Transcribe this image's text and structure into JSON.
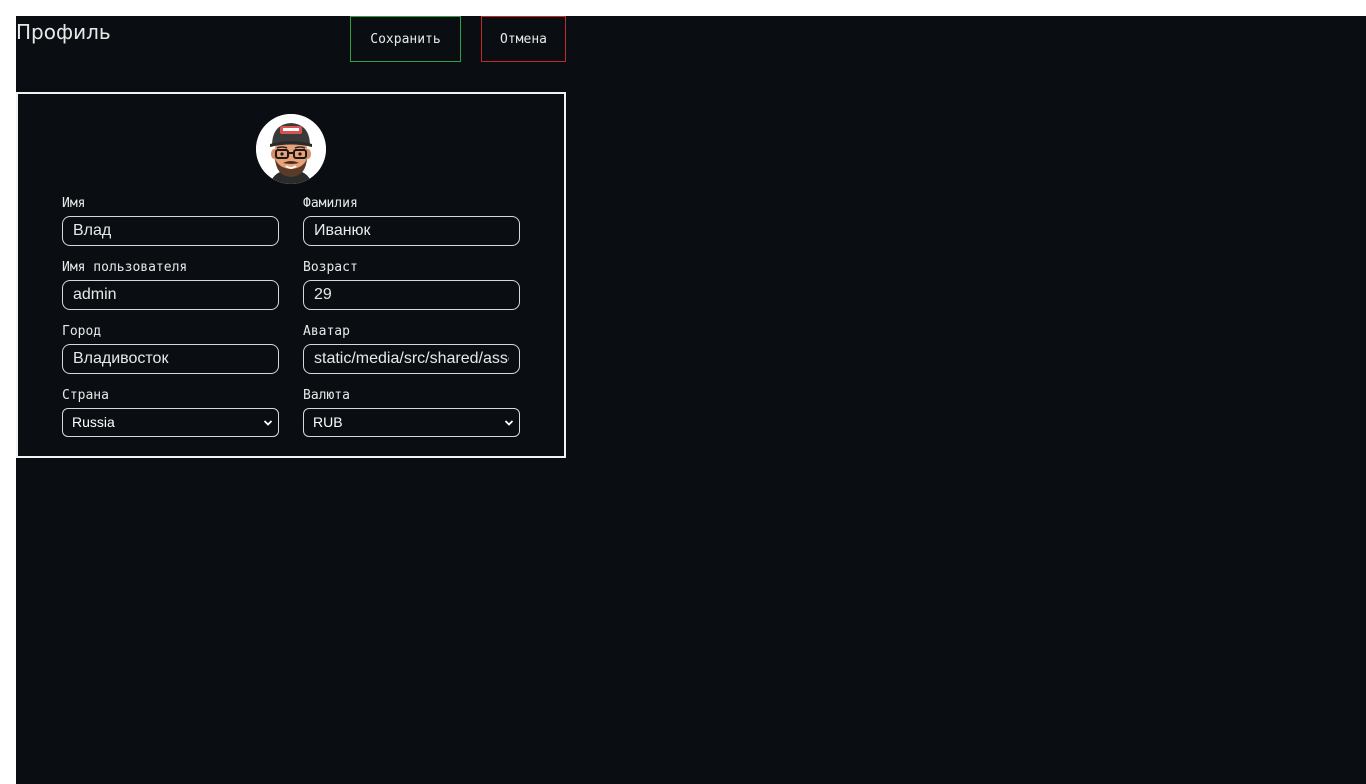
{
  "header": {
    "title": "Профиль",
    "save_label": "Сохранить",
    "cancel_label": "Отмена"
  },
  "profile": {
    "avatar_icon": "avatar-cartoon-man-cap-glasses",
    "first_name": {
      "label": "Имя",
      "value": "Влад"
    },
    "last_name": {
      "label": "Фамилия",
      "value": "Иванюк"
    },
    "username": {
      "label": "Имя пользователя",
      "value": "admin"
    },
    "age": {
      "label": "Возраст",
      "value": "29"
    },
    "city": {
      "label": "Город",
      "value": "Владивосток"
    },
    "avatar": {
      "label": "Аватар",
      "value": "static/media/src/shared/assets/tests/storybook.jpg"
    },
    "country": {
      "label": "Страна",
      "value": "Russia"
    },
    "currency": {
      "label": "Валюта",
      "value": "RUB"
    }
  },
  "colors": {
    "background": "#0a0e12",
    "text": "#e8e8e8",
    "save_border": "#2ea043",
    "cancel_border": "#c62828",
    "card_border": "#f2f2f2"
  }
}
